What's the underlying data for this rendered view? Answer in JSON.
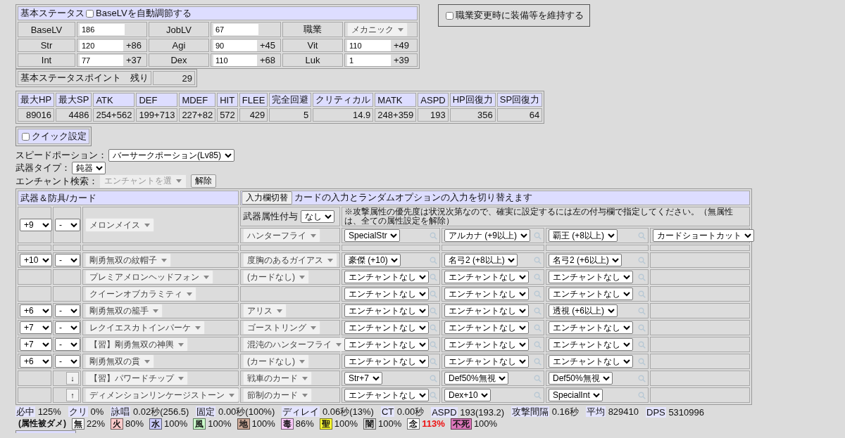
{
  "base_status": {
    "title": "基本ステータス",
    "auto_adjust": {
      "label": "BaseLVを自動調節する",
      "checked": false
    },
    "rows": [
      [
        {
          "label": "BaseLV",
          "value": "186",
          "kind": "input"
        },
        {
          "label": "JobLV",
          "value": "67",
          "kind": "input"
        },
        {
          "label": "職業",
          "value": "メカニック",
          "kind": "dropdown"
        }
      ],
      [
        {
          "label": "Str",
          "value": "120",
          "bonus": "+86",
          "kind": "input"
        },
        {
          "label": "Agi",
          "value": "90",
          "bonus": "+45",
          "kind": "input"
        },
        {
          "label": "Vit",
          "value": "110",
          "bonus": "+49",
          "kind": "input"
        }
      ],
      [
        {
          "label": "Int",
          "value": "77",
          "bonus": "+37",
          "kind": "input"
        },
        {
          "label": "Dex",
          "value": "110",
          "bonus": "+68",
          "kind": "input"
        },
        {
          "label": "Luk",
          "value": "1",
          "bonus": "+39",
          "kind": "input"
        }
      ]
    ],
    "points": {
      "label": "基本ステータスポイント　残り",
      "value": "29"
    }
  },
  "keep_equipment": {
    "label": "職業変更時に装備等を維持する",
    "checked": false
  },
  "stats_table": {
    "columns": [
      "最大HP",
      "最大SP",
      "ATK",
      "DEF",
      "MDEF",
      "HIT",
      "FLEE",
      "完全回避",
      "クリティカル",
      "MATK",
      "ASPD",
      "HP回復力",
      "SP回復力"
    ],
    "values": [
      "89016",
      "4486",
      "254+562",
      "199+713",
      "227+82",
      "572",
      "429",
      "5",
      "14.9",
      "248+359",
      "193",
      "356",
      "64"
    ]
  },
  "quick_settings": {
    "label": "クイック設定",
    "checked": false
  },
  "settings": [
    {
      "kind": "select",
      "label": "スピードポーション：",
      "value": "バーサークポーション(Lv85)"
    },
    {
      "kind": "select",
      "label": "武器タイプ：",
      "value": "鈍器"
    },
    {
      "kind": "search",
      "label": "エンチャント検索：",
      "placeholder": "エンチャントを選",
      "button": "解除"
    }
  ],
  "equipment": {
    "title": "武器＆防具/カード",
    "toggle_button": "入力欄切替",
    "toggle_note": "カードの入力とランダムオプションの入力を切り替えます",
    "weapon": {
      "refine": "+9",
      "grade": "-",
      "item": "メロンメイス",
      "element_label": "武器属性付与",
      "element": "なし",
      "note": "※攻撃属性の優先度は状況次第なので、確実に設定するには左の付与欄で指定してください。（無属性は、全ての属性設定を解除）",
      "card": "ハンターフライ",
      "enchants": [
        "SpecialStr",
        "アルカナ (+9以上)",
        "覇王 (+8以上)"
      ],
      "shortcut": "カードショートカット"
    },
    "rows": [
      {
        "refine": "+10",
        "grade": "-",
        "item": "剛勇無双の紋帽子",
        "card": "度胸のあるガイアス",
        "enchants": [
          "豪傑 (+10)",
          "名弓2 (+8以上)",
          "名弓2 (+6以上)"
        ]
      },
      {
        "item": "プレミアメロンヘッドフォン",
        "card": "(カードなし)",
        "enchants": [
          "エンチャントなし",
          "エンチャントなし",
          "エンチャントなし"
        ]
      },
      {
        "item": "クイーンオブカラミティ",
        "enchants": [
          "エンチャントなし",
          "エンチャントなし",
          "エンチャントなし"
        ]
      },
      {
        "refine": "+6",
        "grade": "-",
        "item": "剛勇無双の籠手",
        "card": "アリス",
        "enchants": [
          "エンチャントなし",
          "エンチャントなし",
          "透視 (+6以上)"
        ]
      },
      {
        "refine": "+7",
        "grade": "-",
        "item": "レクイエスカトインパーケ",
        "card": "ゴーストリング",
        "enchants": [
          "エンチャントなし",
          "エンチャントなし",
          "エンチャントなし"
        ]
      },
      {
        "refine": "+7",
        "grade": "-",
        "item": "【習】剛勇無双の神輿",
        "card": "混沌のハンターフライ",
        "enchants": [
          "エンチャントなし",
          "エンチャントなし",
          "エンチャントなし"
        ]
      },
      {
        "refine": "+6",
        "grade": "-",
        "item": "剛勇無双の貫",
        "card": "(カードなし)",
        "enchants": [
          "エンチャントなし",
          "エンチャントなし",
          "エンチャントなし"
        ]
      },
      {
        "move": "↓",
        "item": "【習】パワードチップ",
        "card": "戦車のカード",
        "enchants": [
          "Str+7",
          "Def50%無視",
          "Def50%無視"
        ]
      },
      {
        "move": "↑",
        "item": "ディメンションリンケージストーン",
        "card": "節制のカード",
        "enchants": [
          "エンチャントなし",
          "Dex+10",
          "SpecialInt"
        ]
      }
    ]
  },
  "summary": {
    "items": [
      {
        "label": "必中",
        "value": "125%"
      },
      {
        "label": "クリ",
        "value": "0%"
      },
      {
        "label": "詠唱",
        "value": "0.02秒(256.5)"
      },
      {
        "label": "固定",
        "value": "0.00秒(100%)"
      },
      {
        "label": "ディレイ",
        "value": "0.06秒(13%)"
      },
      {
        "label": "CT",
        "value": "0.00秒"
      },
      {
        "label": "ASPD",
        "value": "193(193.2)"
      },
      {
        "label": "攻撃間隔",
        "value": "0.16秒"
      },
      {
        "label": "平均",
        "value": "829410"
      },
      {
        "label": "DPS",
        "value": "5310996"
      }
    ],
    "resist_label": "(属性被ダメ)",
    "resists": [
      {
        "element": "無",
        "value": "22%",
        "color": "#ffffff",
        "emphasis": false
      },
      {
        "element": "火",
        "value": "80%",
        "color": "#ffcccc",
        "emphasis": false
      },
      {
        "element": "水",
        "value": "100%",
        "color": "#ccccff",
        "emphasis": false
      },
      {
        "element": "風",
        "value": "100%",
        "color": "#ccffcc",
        "emphasis": false
      },
      {
        "element": "地",
        "value": "100%",
        "color": "#ccaa99",
        "emphasis": false
      },
      {
        "element": "毒",
        "value": "86%",
        "color": "#ffccff",
        "emphasis": false
      },
      {
        "element": "聖",
        "value": "100%",
        "color": "#ffff33",
        "emphasis": false
      },
      {
        "element": "闇",
        "value": "100%",
        "color": "#dddddd",
        "emphasis": false
      },
      {
        "element": "念",
        "value": "113%",
        "color": "#fefefe",
        "emphasis": true
      },
      {
        "element": "不死",
        "value": "100%",
        "color": "#dd77bb",
        "emphasis": false
      }
    ]
  }
}
